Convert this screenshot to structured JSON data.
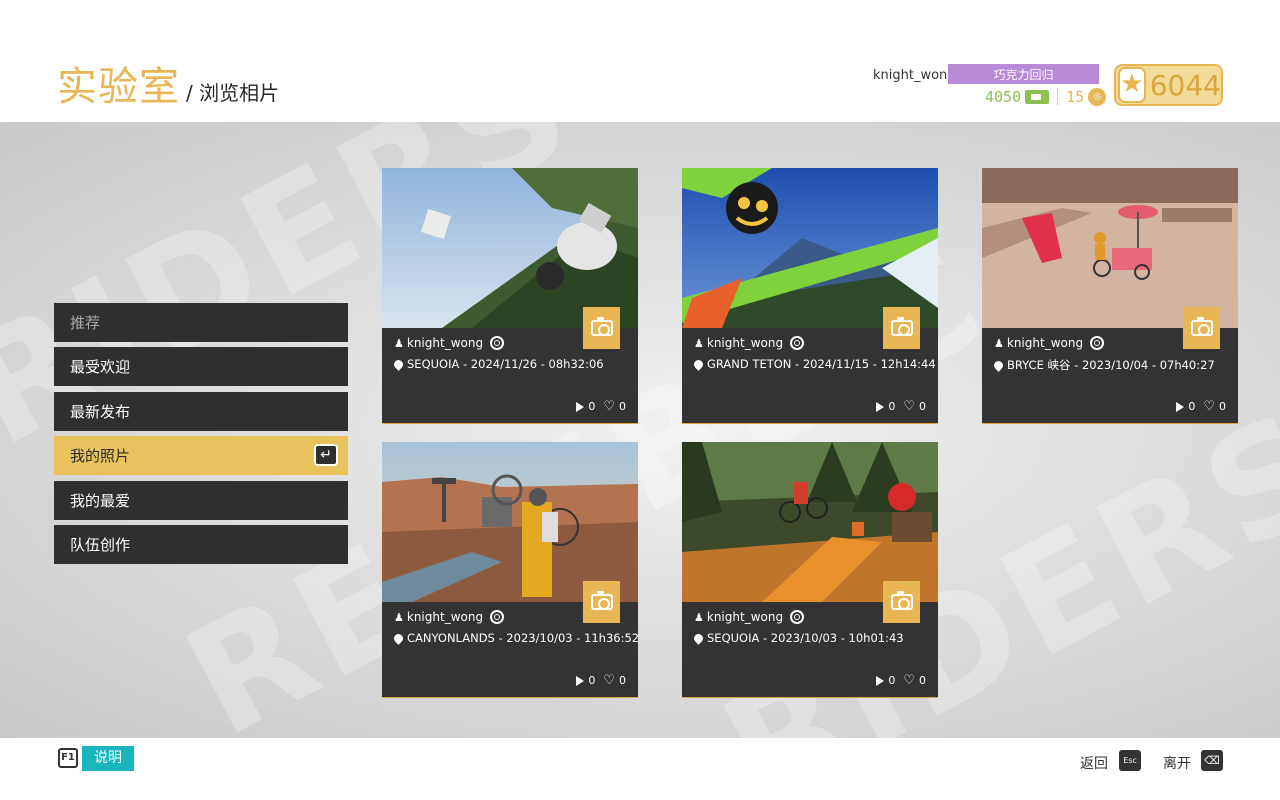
{
  "header": {
    "title": "实验室",
    "subtitle": "/ 浏览相片",
    "username": "knight_wong",
    "badge": "巧克力回归",
    "xp": "4050",
    "coins": "15",
    "stars": "6044",
    "icons": {
      "xp": "xp-icon",
      "coins": "coin-icon",
      "stars": "star-icon"
    },
    "colors": {
      "accent": "#e8b654",
      "badge": "#b98ad6",
      "xp": "#8cc152"
    }
  },
  "menu": {
    "items": [
      {
        "label": "推荐"
      },
      {
        "label": "最受欢迎"
      },
      {
        "label": "最新发布"
      },
      {
        "label": "我的照片"
      },
      {
        "label": "我的最爱"
      },
      {
        "label": "队伍创作"
      }
    ],
    "active_index": 3,
    "active_icon": "enter-key-icon"
  },
  "cards": [
    {
      "author": "knight_wong",
      "location": "SEQUOIA - 2024/11/26 - 08h32:06",
      "plays": "0",
      "likes": "0"
    },
    {
      "author": "knight_wong",
      "location": "GRAND TETON - 2024/11/15 - 12h14:44",
      "plays": "0",
      "likes": "0"
    },
    {
      "author": "knight_wong",
      "location": "BRYCE 峡谷 - 2023/10/04 - 07h40:27",
      "plays": "0",
      "likes": "0"
    },
    {
      "author": "knight_wong",
      "location": "CANYONLANDS - 2023/10/03 - 11h36:52",
      "plays": "0",
      "likes": "0"
    },
    {
      "author": "knight_wong",
      "location": "SEQUOIA - 2023/10/03 - 10h01:43",
      "plays": "0",
      "likes": "0"
    }
  ],
  "footer": {
    "help_key": "F1",
    "help_label": "说明",
    "back_label": "返回",
    "back_key": "Esc",
    "quit_label": "离开",
    "quit_key": "⌫"
  }
}
